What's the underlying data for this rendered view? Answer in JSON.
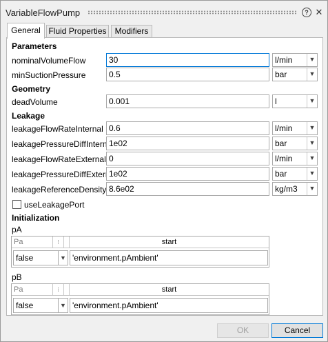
{
  "window": {
    "title": "VariableFlowPump",
    "help_icon": "?",
    "close_icon": "✕"
  },
  "tabs": [
    {
      "label": "General",
      "active": true
    },
    {
      "label": "Fluid Properties",
      "active": false
    },
    {
      "label": "Modifiers",
      "active": false
    }
  ],
  "sections": {
    "parameters": "Parameters",
    "geometry": "Geometry",
    "leakage": "Leakage",
    "initialization": "Initialization"
  },
  "params": [
    {
      "label": "nominalVolumeFlow",
      "value": "30",
      "unit": "l/min"
    },
    {
      "label": "minSuctionPressure",
      "value": "0.5",
      "unit": "bar"
    },
    {
      "label": "deadVolume",
      "value": "0.001",
      "unit": "l"
    },
    {
      "label": "leakageFlowRateInternal",
      "value": "0.6",
      "unit": "l/min"
    },
    {
      "label": "leakagePressureDiffInternal",
      "value": "1e02",
      "unit": "bar"
    },
    {
      "label": "leakageFlowRateExternal",
      "value": "0",
      "unit": "l/min"
    },
    {
      "label": "leakagePressureDiffExternal",
      "value": "1e02",
      "unit": "bar"
    },
    {
      "label": "leakageReferenceDensity",
      "value": "8.6e02",
      "unit": "kg/m3"
    }
  ],
  "use_leakage_port": {
    "label": "useLeakagePort",
    "checked": false
  },
  "init": [
    {
      "label": "pA",
      "header_unit": "Pa",
      "header_start": "start",
      "fixed": "false",
      "start": "'environment.pAmbient'"
    },
    {
      "label": "pB",
      "header_unit": "Pa",
      "header_start": "start",
      "fixed": "false",
      "start": "'environment.pAmbient'"
    }
  ],
  "buttons": {
    "ok": "OK",
    "cancel": "Cancel"
  }
}
